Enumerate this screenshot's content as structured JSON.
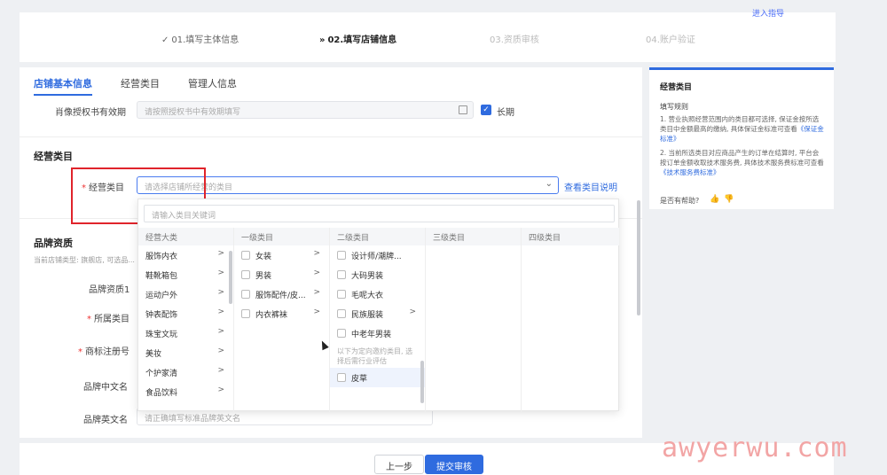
{
  "top_link": "进入指导",
  "steps": [
    {
      "mark": "✓",
      "label": "01.填写主体信息"
    },
    {
      "mark": "»",
      "label": "02.填写店铺信息"
    },
    {
      "mark": "",
      "label": "03.资质审核"
    },
    {
      "mark": "",
      "label": "04.账户验证"
    }
  ],
  "tabs": [
    "店铺基本信息",
    "经营类目",
    "管理人信息"
  ],
  "portrait": {
    "label": "肖像授权书有效期",
    "placeholder": "请按照授权书中有效期填写",
    "checkbox_mark": "✓",
    "long_term": "长期"
  },
  "category_section": {
    "title": "经营类目",
    "label": "经营类目",
    "required": "*",
    "placeholder": "请选择店铺所经营的类目",
    "help_link": "查看类目说明"
  },
  "dropdown": {
    "search_placeholder": "请输入类目关键词",
    "columns": [
      "经营大类",
      "一级类目",
      "二级类目",
      "三级类目",
      "四级类目"
    ],
    "major": [
      "服饰内衣",
      "鞋靴箱包",
      "运动户外",
      "钟表配饰",
      "珠宝文玩",
      "美妆",
      "个护家清",
      "食品饮料"
    ],
    "level1": [
      "女装",
      "男装",
      "服饰配件/皮...",
      "内衣裤袜"
    ],
    "level2": [
      "设计师/潮牌...",
      "大码男装",
      "毛呢大衣",
      "民族服装",
      "中老年男装"
    ],
    "level2_note": "以下为定向邀约类目, 选择后需行业评估",
    "level2_special": "皮草",
    "arrow": ">"
  },
  "brand": {
    "title": "品牌资质",
    "hint": "当前店铺类型: 旗舰店, 可选品...",
    "brand1": "品牌资质1",
    "owner": "所属类目",
    "trademark": "商标注册号",
    "cn_name": "品牌中文名",
    "en_name": "品牌英文名",
    "en_placeholder": "请正确填写标准品牌英文名",
    "required": "*"
  },
  "side": {
    "title": "经营类目",
    "subtitle": "填写规则",
    "rule1": "1. 营业执照经营范围内的类目都可选择, 保证金按所选类目中金额最高的缴纳, 具体保证金标准可查看",
    "rule1_link": "《保证金标准》",
    "rule2": "2. 当前所选类目对应商品产生的订单在结算时, 平台会按订单金额收取技术服务费, 具体技术服务费标准可查看",
    "rule2_link": "《技术服务费标准》",
    "helpful": "是否有帮助?",
    "thumb_up": "👍",
    "thumb_down": "👎"
  },
  "buttons": {
    "prev": "上一步",
    "submit": "提交审核"
  },
  "watermark": "awyerwu.com"
}
